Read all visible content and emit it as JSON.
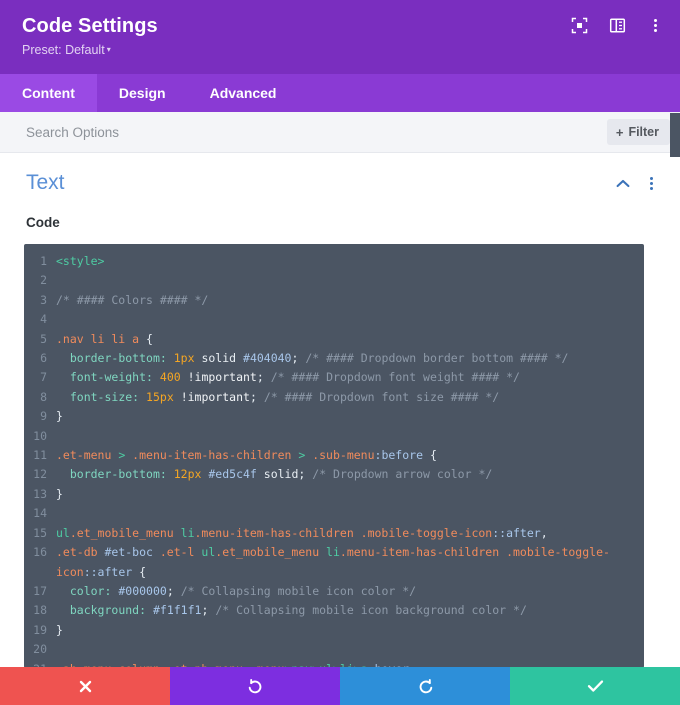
{
  "header": {
    "title": "Code Settings",
    "preset_label": "Preset: Default",
    "preset_caret": "▾",
    "icons": [
      {
        "name": "responsive-view-icon",
        "glyph": "⬚"
      },
      {
        "name": "layout-columns-icon",
        "glyph": "▤"
      },
      {
        "name": "more-options-icon",
        "glyph": "⋮"
      }
    ]
  },
  "tabs": [
    {
      "label": "Content",
      "active": true
    },
    {
      "label": "Design",
      "active": false
    },
    {
      "label": "Advanced",
      "active": false
    }
  ],
  "search": {
    "placeholder": "Search Options",
    "value": "",
    "filter_label": "Filter",
    "filter_plus": "+"
  },
  "section": {
    "title": "Text",
    "collapse_icon": "chevron-up",
    "menu_icon": "more-vertical"
  },
  "field": {
    "label": "Code"
  },
  "footer": {
    "buttons": [
      {
        "name": "cancel-button",
        "icon": "close-x",
        "color": "#ef5350"
      },
      {
        "name": "undo-button",
        "icon": "undo-arrow",
        "color": "#7d2ee0"
      },
      {
        "name": "redo-button",
        "icon": "redo-arrow",
        "color": "#2d8fd9"
      },
      {
        "name": "save-button",
        "icon": "check",
        "color": "#2ec4a0"
      }
    ]
  },
  "colors": {
    "header_purple": "#7a2ebf",
    "tabs_purple": "#8a3ad4",
    "tab_active_purple": "#9a4ae4",
    "code_bg": "#4b5563",
    "section_title_blue": "#5a8fd6",
    "search_bg": "#f4f5f8"
  },
  "code": {
    "language": "css",
    "lines": [
      {
        "n": "1",
        "tokens": [
          {
            "t": "tag",
            "s": "<style>"
          }
        ]
      },
      {
        "n": "2",
        "tokens": []
      },
      {
        "n": "3",
        "tokens": [
          {
            "t": "com",
            "s": "/* #### Colors #### */"
          }
        ]
      },
      {
        "n": "4",
        "tokens": []
      },
      {
        "n": "5",
        "tokens": [
          {
            "t": "sel",
            "s": ".nav li li a "
          },
          {
            "t": "punc",
            "s": "{"
          }
        ]
      },
      {
        "n": "6",
        "tokens": [
          {
            "t": "plain",
            "s": "  "
          },
          {
            "t": "prop",
            "s": "border-bottom:"
          },
          {
            "t": "plain",
            "s": " "
          },
          {
            "t": "num",
            "s": "1px"
          },
          {
            "t": "plain",
            "s": " "
          },
          {
            "t": "val",
            "s": "solid"
          },
          {
            "t": "plain",
            "s": " "
          },
          {
            "t": "hex",
            "s": "#404040"
          },
          {
            "t": "punc",
            "s": ";"
          },
          {
            "t": "plain",
            "s": " "
          },
          {
            "t": "com",
            "s": "/* #### Dropdown border bottom #### */"
          }
        ]
      },
      {
        "n": "7",
        "tokens": [
          {
            "t": "plain",
            "s": "  "
          },
          {
            "t": "prop",
            "s": "font-weight:"
          },
          {
            "t": "plain",
            "s": " "
          },
          {
            "t": "num",
            "s": "400"
          },
          {
            "t": "plain",
            "s": " "
          },
          {
            "t": "imp",
            "s": "!important"
          },
          {
            "t": "punc",
            "s": ";"
          },
          {
            "t": "plain",
            "s": " "
          },
          {
            "t": "com",
            "s": "/* #### Dropdown font weight #### */"
          }
        ]
      },
      {
        "n": "8",
        "tokens": [
          {
            "t": "plain",
            "s": "  "
          },
          {
            "t": "prop",
            "s": "font-size:"
          },
          {
            "t": "plain",
            "s": " "
          },
          {
            "t": "num",
            "s": "15px"
          },
          {
            "t": "plain",
            "s": " "
          },
          {
            "t": "imp",
            "s": "!important"
          },
          {
            "t": "punc",
            "s": ";"
          },
          {
            "t": "plain",
            "s": " "
          },
          {
            "t": "com",
            "s": "/* #### Dropdown font size #### */"
          }
        ]
      },
      {
        "n": "9",
        "tokens": [
          {
            "t": "punc",
            "s": "}"
          }
        ]
      },
      {
        "n": "10",
        "tokens": []
      },
      {
        "n": "11",
        "tokens": [
          {
            "t": "sel",
            "s": ".et-menu "
          },
          {
            "t": "op",
            "s": ">"
          },
          {
            "t": "sel",
            "s": " .menu-item-has-children "
          },
          {
            "t": "op",
            "s": ">"
          },
          {
            "t": "sel",
            "s": " .sub-menu"
          },
          {
            "t": "hex",
            "s": ":before"
          },
          {
            "t": "plain",
            "s": " "
          },
          {
            "t": "punc",
            "s": "{"
          }
        ]
      },
      {
        "n": "12",
        "tokens": [
          {
            "t": "plain",
            "s": "  "
          },
          {
            "t": "prop",
            "s": "border-bottom:"
          },
          {
            "t": "plain",
            "s": " "
          },
          {
            "t": "num",
            "s": "12px"
          },
          {
            "t": "plain",
            "s": " "
          },
          {
            "t": "hex",
            "s": "#ed5c4f"
          },
          {
            "t": "plain",
            "s": " "
          },
          {
            "t": "val",
            "s": "solid"
          },
          {
            "t": "punc",
            "s": ";"
          },
          {
            "t": "plain",
            "s": " "
          },
          {
            "t": "com",
            "s": "/* Dropdown arrow color */"
          }
        ]
      },
      {
        "n": "13",
        "tokens": [
          {
            "t": "punc",
            "s": "}"
          }
        ]
      },
      {
        "n": "14",
        "tokens": []
      },
      {
        "n": "15",
        "tokens": [
          {
            "t": "elem",
            "s": "ul"
          },
          {
            "t": "sel",
            "s": ".et_mobile_menu "
          },
          {
            "t": "elem",
            "s": "li"
          },
          {
            "t": "sel",
            "s": ".menu-item-has-children .mobile-toggle-icon"
          },
          {
            "t": "hex",
            "s": "::after"
          },
          {
            "t": "punc",
            "s": ","
          }
        ]
      },
      {
        "n": "16",
        "tokens": [
          {
            "t": "sel",
            "s": ".et-db "
          },
          {
            "t": "hex",
            "s": "#et-boc"
          },
          {
            "t": "sel",
            "s": " .et-l "
          },
          {
            "t": "elem",
            "s": "ul"
          },
          {
            "t": "sel",
            "s": ".et_mobile_menu "
          },
          {
            "t": "elem",
            "s": "li"
          },
          {
            "t": "sel",
            "s": ".menu-item-has-children .mobile-toggle-icon"
          },
          {
            "t": "hex",
            "s": "::after"
          },
          {
            "t": "plain",
            "s": " "
          },
          {
            "t": "punc",
            "s": "{"
          }
        ]
      },
      {
        "n": "17",
        "tokens": [
          {
            "t": "plain",
            "s": "  "
          },
          {
            "t": "prop",
            "s": "color:"
          },
          {
            "t": "plain",
            "s": " "
          },
          {
            "t": "hex",
            "s": "#000000"
          },
          {
            "t": "punc",
            "s": ";"
          },
          {
            "t": "plain",
            "s": " "
          },
          {
            "t": "com",
            "s": "/* Collapsing mobile icon color */"
          }
        ]
      },
      {
        "n": "18",
        "tokens": [
          {
            "t": "plain",
            "s": "  "
          },
          {
            "t": "prop",
            "s": "background:"
          },
          {
            "t": "plain",
            "s": " "
          },
          {
            "t": "hex",
            "s": "#f1f1f1"
          },
          {
            "t": "punc",
            "s": ";"
          },
          {
            "t": "plain",
            "s": " "
          },
          {
            "t": "com",
            "s": "/* Collapsing mobile icon background color */"
          }
        ]
      },
      {
        "n": "19",
        "tokens": [
          {
            "t": "punc",
            "s": "}"
          }
        ]
      },
      {
        "n": "20",
        "tokens": []
      },
      {
        "n": "21",
        "tokens": [
          {
            "t": "sel",
            "s": ".ah-menu-column .et_pb_menu__menu"
          },
          {
            "t": "op",
            "s": ">"
          },
          {
            "t": "elem",
            "s": "nav"
          },
          {
            "t": "op",
            "s": ">"
          },
          {
            "t": "elem",
            "s": "ul"
          },
          {
            "t": "op",
            "s": ">"
          },
          {
            "t": "elem",
            "s": "li"
          },
          {
            "t": "op",
            "s": ">"
          },
          {
            "t": "elem",
            "s": "a"
          },
          {
            "t": "hex",
            "s": ":hover"
          },
          {
            "t": "punc",
            "s": ","
          }
        ]
      }
    ]
  }
}
